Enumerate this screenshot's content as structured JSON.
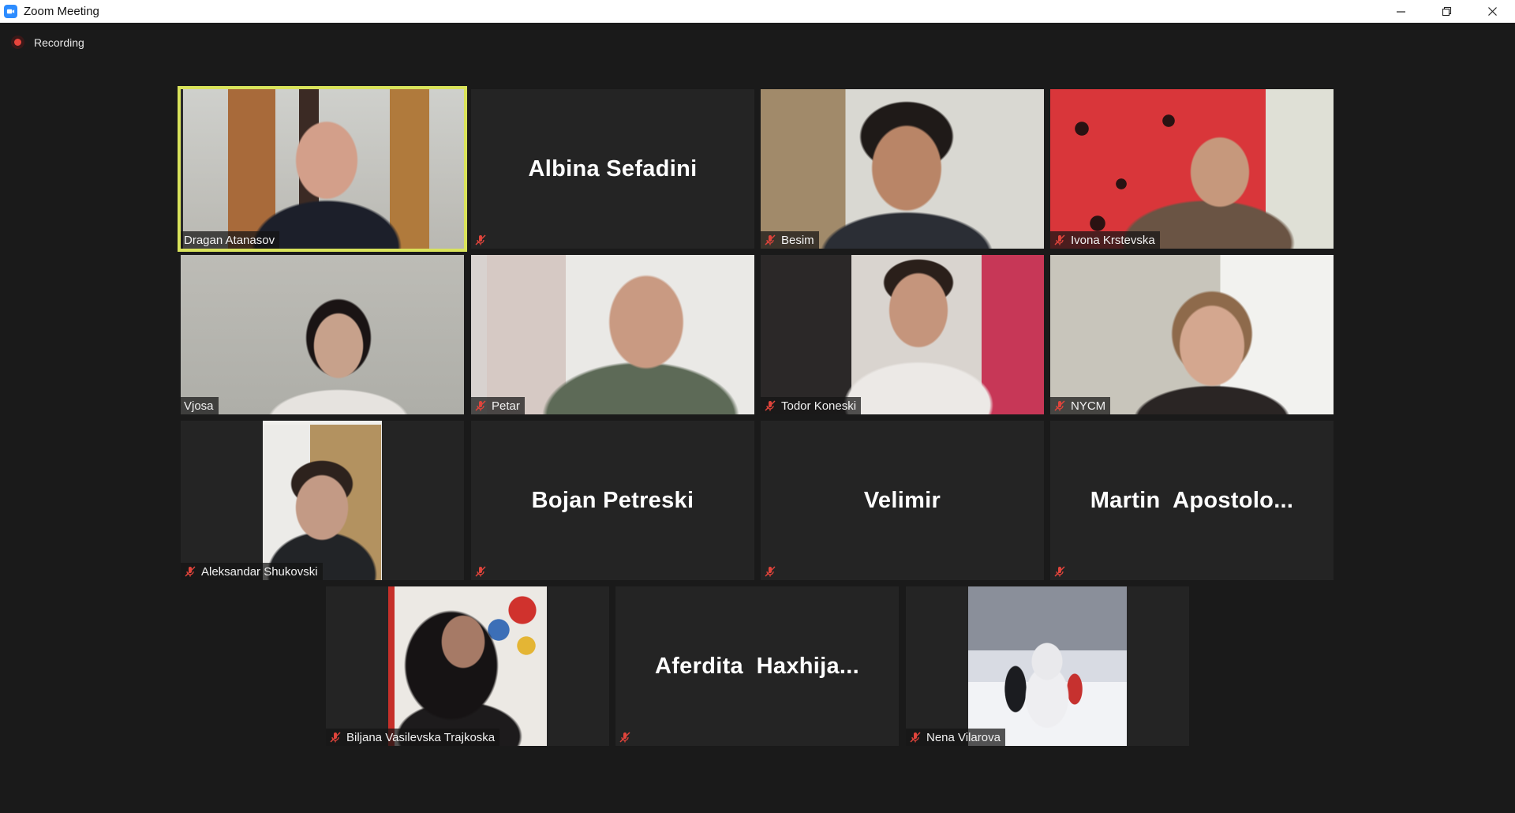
{
  "window": {
    "title": "Zoom Meeting",
    "recording_label": "Recording"
  },
  "participants": [
    {
      "name": "Dragan Atanasov",
      "muted": false,
      "video": true,
      "active_speaker": true
    },
    {
      "name": "Albina Sefadini",
      "muted": true,
      "video": false
    },
    {
      "name": "Besim",
      "muted": true,
      "video": true
    },
    {
      "name": "Ivona Krstevska",
      "muted": true,
      "video": true
    },
    {
      "name": "Vjosa",
      "muted": false,
      "video": true
    },
    {
      "name": "Petar",
      "muted": true,
      "video": true
    },
    {
      "name": "Todor Koneski",
      "muted": true,
      "video": true
    },
    {
      "name": "NYCM",
      "muted": true,
      "video": true
    },
    {
      "name": "Aleksandar Shukovski",
      "muted": true,
      "video": true
    },
    {
      "name": "Bojan Petreski",
      "muted": true,
      "video": false
    },
    {
      "name": "Velimir",
      "muted": true,
      "video": false
    },
    {
      "name": "Martin  Apostolo...",
      "muted": true,
      "video": false
    },
    {
      "name": "Biljana Vasilevska Trajkoska",
      "muted": true,
      "video": true
    },
    {
      "name": "Aferdita  Haxhija...",
      "muted": true,
      "video": false
    },
    {
      "name": "Nena Vilarova",
      "muted": true,
      "video": true
    }
  ],
  "colors": {
    "active_speaker_border": "#d9e35b",
    "muted_icon": "#e0443b",
    "recording_dot": "#e8453c",
    "background": "#1a1a1a",
    "tile": "#242424"
  }
}
